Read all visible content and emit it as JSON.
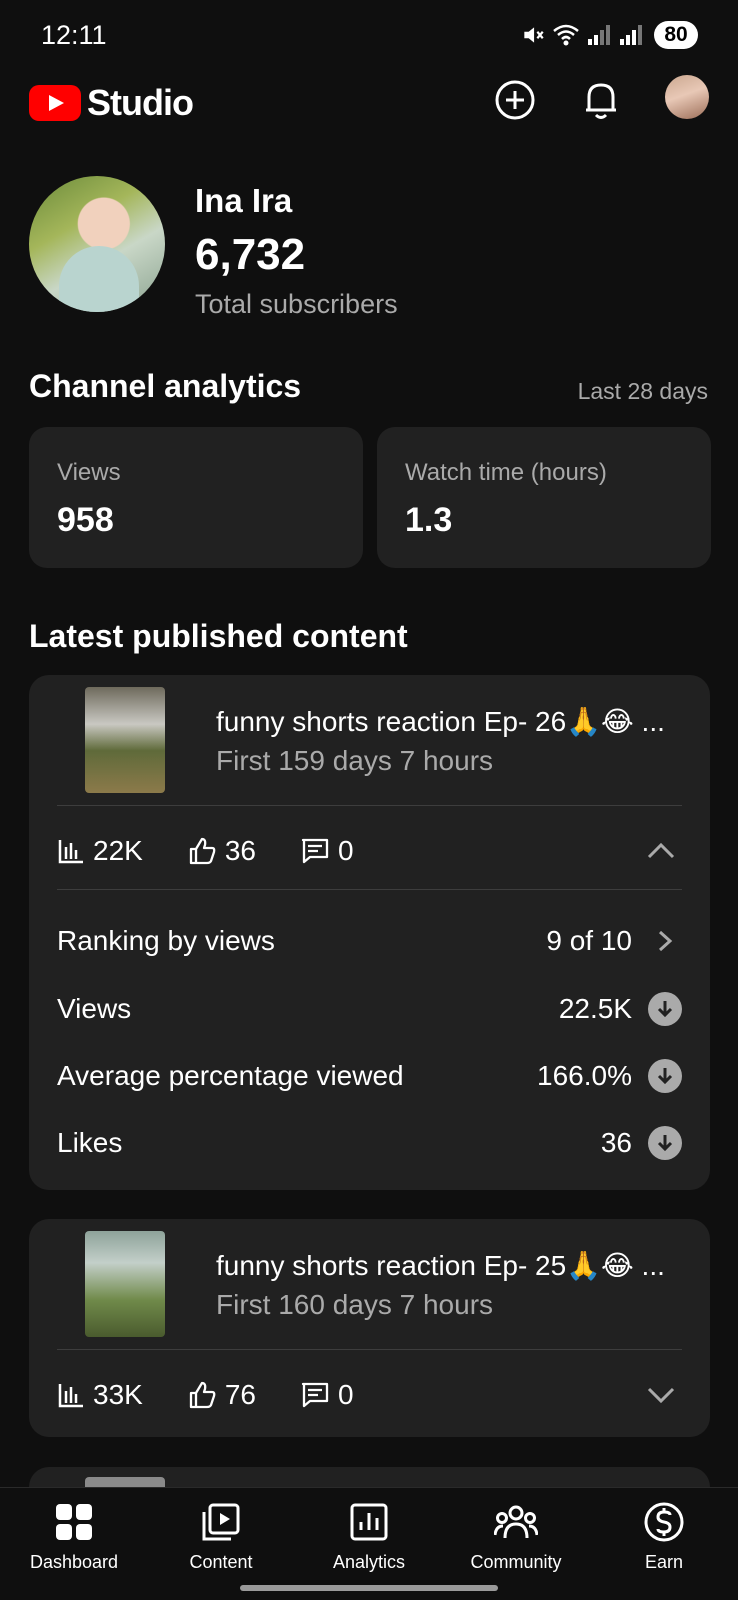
{
  "status_bar": {
    "time": "12:11",
    "battery": "80"
  },
  "app": {
    "logo_text": "Studio"
  },
  "channel": {
    "name": "Ina Ira",
    "subscribers": "6,732",
    "subscribers_label": "Total subscribers"
  },
  "analytics": {
    "title": "Channel analytics",
    "range": "Last 28 days",
    "stats": [
      {
        "label": "Views",
        "value": "958"
      },
      {
        "label": "Watch time (hours)",
        "value": "1.3"
      }
    ]
  },
  "latest": {
    "title": "Latest published content",
    "items": [
      {
        "title": "funny shorts reaction Ep- 26🙏😂 ...",
        "subtitle": "First 159 days 7 hours",
        "views": "22K",
        "likes": "36",
        "comments": "0",
        "expanded": true,
        "details": [
          {
            "label": "Ranking by views",
            "value": "9 of 10",
            "icon": "chevron-right-icon"
          },
          {
            "label": "Views",
            "value": "22.5K",
            "icon": "arrow-down-circle-icon"
          },
          {
            "label": "Average percentage viewed",
            "value": "166.0%",
            "icon": "arrow-down-circle-icon"
          },
          {
            "label": "Likes",
            "value": "36",
            "icon": "arrow-down-circle-icon"
          }
        ]
      },
      {
        "title": "funny shorts reaction Ep- 25🙏😂 ...",
        "subtitle": "First 160 days 7 hours",
        "views": "33K",
        "likes": "76",
        "comments": "0",
        "expanded": false
      }
    ]
  },
  "nav": [
    {
      "label": "Dashboard",
      "icon": "dashboard-icon"
    },
    {
      "label": "Content",
      "icon": "content-icon"
    },
    {
      "label": "Analytics",
      "icon": "analytics-icon"
    },
    {
      "label": "Community",
      "icon": "community-icon"
    },
    {
      "label": "Earn",
      "icon": "earn-icon"
    }
  ],
  "colors": {
    "background": "#0f0f0f",
    "card": "#212121",
    "accent": "#ff0000",
    "muted": "#aaaaaa"
  }
}
